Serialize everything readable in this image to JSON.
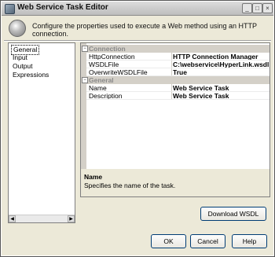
{
  "window": {
    "title": "Web Service Task Editor",
    "description": "Configure the properties used to execute a Web method using an HTTP connection."
  },
  "nav": {
    "items": [
      {
        "label": "General",
        "selected": true
      },
      {
        "label": "Input"
      },
      {
        "label": "Output"
      },
      {
        "label": "Expressions"
      }
    ]
  },
  "grid": {
    "categories": [
      {
        "label": "Connection",
        "rows": [
          {
            "name": "HttpConnection",
            "value": "HTTP Connection Manager"
          },
          {
            "name": "WSDLFile",
            "value": "C:\\webservice\\HyperLink.wsdl"
          },
          {
            "name": "OverwriteWSDLFile",
            "value": "True"
          }
        ]
      },
      {
        "label": "General",
        "rows": [
          {
            "name": "Name",
            "value": "Web Service Task",
            "selected": true
          },
          {
            "name": "Description",
            "value": "Web Service Task"
          }
        ]
      }
    ]
  },
  "description_panel": {
    "title": "Name",
    "text": "Specifies the name of the task."
  },
  "buttons": {
    "download_wsdl": "Download WSDL",
    "ok": "OK",
    "cancel": "Cancel",
    "help": "Help"
  },
  "titlebar_buttons": {
    "minimize": "_",
    "maximize": "□",
    "close": "×"
  }
}
